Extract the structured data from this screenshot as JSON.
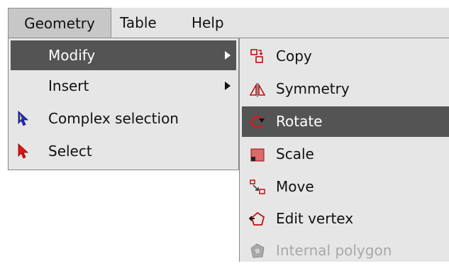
{
  "menubar": {
    "items": [
      {
        "label": "Geometry"
      },
      {
        "label": "Table"
      },
      {
        "label": "Help"
      }
    ]
  },
  "geometry_menu": {
    "items": [
      {
        "label": "Modify",
        "icon": null,
        "has_submenu": true
      },
      {
        "label": "Insert",
        "icon": null,
        "has_submenu": true
      },
      {
        "label": "Complex selection",
        "icon": "blue-yellow-cursor-icon"
      },
      {
        "label": "Select",
        "icon": "red-cursor-icon"
      }
    ]
  },
  "modify_submenu": {
    "items": [
      {
        "label": "Copy",
        "icon": "copy-icon"
      },
      {
        "label": "Symmetry",
        "icon": "symmetry-icon"
      },
      {
        "label": "Rotate",
        "icon": "rotate-icon"
      },
      {
        "label": "Scale",
        "icon": "scale-icon"
      },
      {
        "label": "Move",
        "icon": "move-icon"
      },
      {
        "label": "Edit vertex",
        "icon": "edit-vertex-icon"
      },
      {
        "label": "Internal polygon",
        "icon": "internal-polygon-icon",
        "disabled": true
      }
    ]
  },
  "colors": {
    "menubar_bg": "#e4e4e4",
    "menu_bg": "#e6e6e6",
    "highlight_bg": "#545454",
    "highlight_text": "#ffffff",
    "disabled_text": "#a8a8a8",
    "icon_red": "#d01010"
  }
}
